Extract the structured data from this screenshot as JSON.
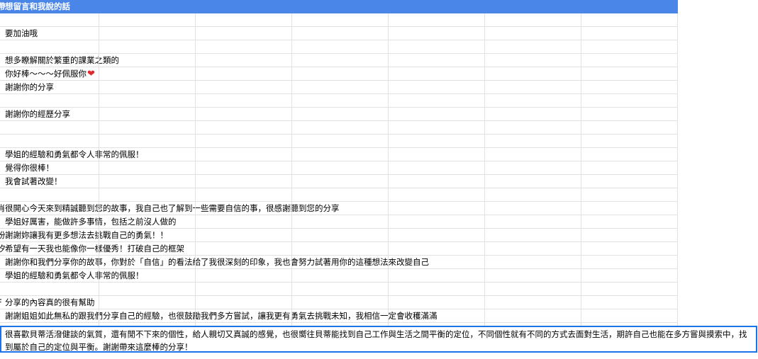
{
  "sheet": {
    "header": {
      "edge_char": "帶",
      "title": "想留言和我說的話"
    },
    "rows": [
      {
        "text": ""
      },
      {
        "text": "要加油哦"
      },
      {
        "text": ""
      },
      {
        "text": "想多瞭解關於繁重的課業之類的"
      },
      {
        "text": "你好棒～～～好佩服你",
        "suffix_icon": "heart"
      },
      {
        "text": "謝謝你的分享"
      },
      {
        "text": ""
      },
      {
        "text": "謝謝你的經歷分享"
      },
      {
        "text": ""
      },
      {
        "text": ""
      },
      {
        "text": "學姐的經驗和勇氣都令人非常的佩服！"
      },
      {
        "text": "覺得你很棒！"
      },
      {
        "text": "我會試著改變！"
      },
      {
        "text": ""
      },
      {
        "edge": "肖",
        "text": "很開心今天來到精誠聽到您的故事，我自己也了解到一些需要自信的事，很感謝聽到您的分享"
      },
      {
        "text": "學姐好厲害，能做許多事情，包括之前沒人做的"
      },
      {
        "edge": "汾",
        "text": "謝謝妳讓我有更多想法去挑戰自己的勇氣！！"
      },
      {
        "edge": "汐",
        "text": "希望有一天我也能像你一樣優秀！打破自己的框架"
      },
      {
        "text": "謝謝你和我們分享你的故事，你對於「自信」的看法給了我很深刻的印象，我也會努力試著用你的這種想法來改變自己"
      },
      {
        "text": "學姐的經驗和勇氣都令人非常的佩服！"
      },
      {
        "text": ""
      },
      {
        "edge": "F",
        "text": "分享的內容真的很有幫助"
      },
      {
        "text": "謝謝姐姐如此無私的跟我們分享自己的經驗，也很鼓勵我們多方嘗試，讓我更有勇氣去挑戰未知，我相信一定會收穫滿滿"
      }
    ],
    "selected_cell": {
      "text": "很喜歡貝蒂活潑健談的氣質，還有閒不下來的個性，給人親切又真誠的感覺，也很嚮往貝蒂能找到自己工作與生活之間平衡的定位，不同個性就有不同的方式去面對生活，期許自己也能在多方嘗與摸索中，找到屬於自己的定位與平衡。謝謝帶來這麼棒的分享！"
    },
    "colors": {
      "header_bg": "#4a86e8",
      "selection_border": "#1a73e8",
      "heart": "#e3262b"
    }
  }
}
